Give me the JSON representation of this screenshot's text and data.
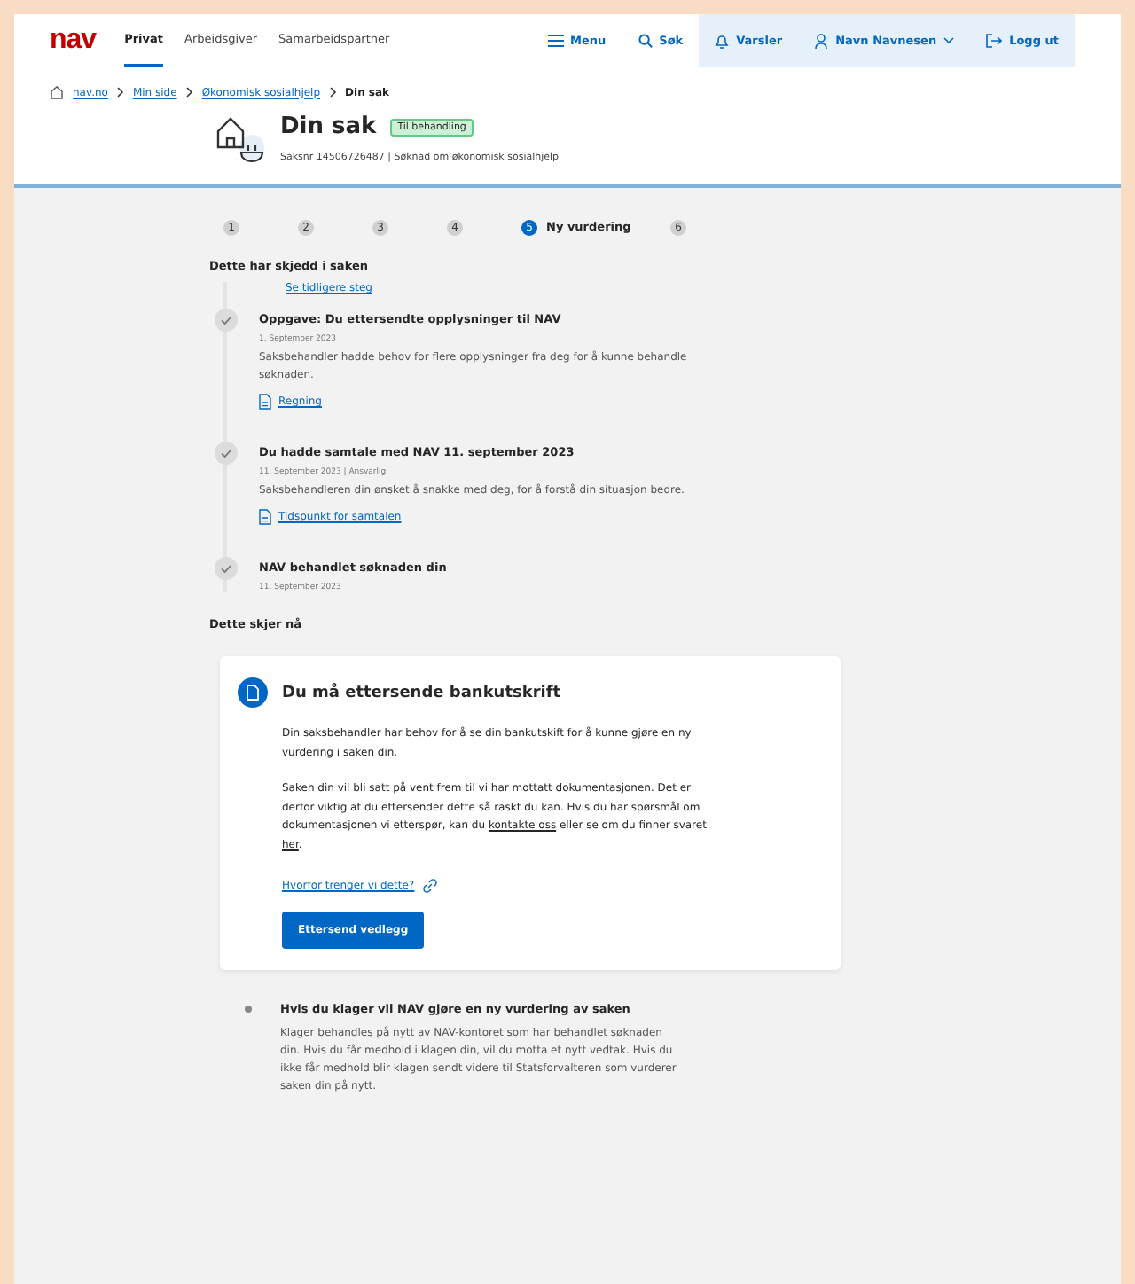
{
  "header": {
    "logo": "nav",
    "tabs": [
      {
        "label": "Privat",
        "selected": true
      },
      {
        "label": "Arbeidsgiver",
        "selected": false
      },
      {
        "label": "Samarbeidspartner",
        "selected": false
      }
    ],
    "actions": [
      {
        "label": "Menu",
        "kind": "menu",
        "highlighted": false
      },
      {
        "label": "Søk",
        "kind": "search",
        "highlighted": false
      },
      {
        "label": "Varsler",
        "kind": "bell",
        "highlighted": true
      },
      {
        "label": "Navn Navnesen",
        "kind": "user",
        "highlighted": true
      },
      {
        "label": "Logg ut",
        "kind": "logout",
        "highlighted": true
      }
    ]
  },
  "breadcrumbs": [
    {
      "label": "nav.no",
      "link": true
    },
    {
      "label": "Min side",
      "link": true
    },
    {
      "label": "Økonomisk sosialhjelp",
      "link": true
    },
    {
      "label": "Din sak",
      "link": false
    }
  ],
  "case": {
    "title": "Din sak",
    "badge": "Til behandling",
    "meta": "Saksnr 14506726487  |  Søknad om økonomisk sosialhjelp"
  },
  "steps": [
    {
      "number": "1",
      "selected": false
    },
    {
      "number": "2",
      "selected": false
    },
    {
      "number": "3",
      "selected": false
    },
    {
      "number": "4",
      "selected": false
    },
    {
      "number": "5",
      "label": "Ny vurdering",
      "selected": true
    },
    {
      "number": "6",
      "selected": false
    }
  ],
  "history": {
    "heading": "Dette har skjedd i saken",
    "earlier_link": "Se tidligere steg",
    "events": [
      {
        "title": "Oppgave: Du ettersendte opplysninger til NAV",
        "date": "1. September 2023",
        "text": "Saksbehandler hadde behov for flere opplysninger fra deg for å kunne behandle søknaden.",
        "link": "Regning"
      },
      {
        "title": "Du hadde samtale med NAV 11. september 2023",
        "date": "11. September 2023 | Ansvarlig",
        "text": "Saksbehandleren din ønsket å snakke med deg, for å forstå din situasjon bedre.",
        "link": "Tidspunkt for samtalen"
      },
      {
        "title": "NAV behandlet søknaden din",
        "date": "11. September 2023"
      }
    ]
  },
  "now": {
    "heading": "Dette skjer nå",
    "card": {
      "title": "Du må ettersende bankutskrift",
      "paragraphs": [
        [
          {
            "kind": "text",
            "text": "Din saksbehandler har behov for å se din bankutskift for å kunne gjøre en ny vurdering i saken din."
          }
        ],
        [
          {
            "kind": "text",
            "text": "Saken din vil bli satt på vent frem til vi har mottatt dokumentasjonen. Det er derfor viktig at du ettersender dette så raskt du kan. Hvis du har spørsmål om dokumentasjonen vi etterspør, kan du "
          },
          {
            "kind": "link",
            "text": "kontakte oss"
          },
          {
            "kind": "text",
            "text": " eller se om du finner svaret "
          },
          {
            "kind": "link",
            "text": "her"
          },
          {
            "kind": "text",
            "text": "."
          }
        ]
      ],
      "link": "Hvorfor trenger vi dette?",
      "button": "Ettersend vedlegg"
    }
  },
  "upcoming": [
    {
      "title": "Hvis du klager vil NAV gjøre en ny vurdering av saken",
      "text": "Klager behandles på nytt av NAV-kontoret som har behandlet søknaden din. Hvis du får medhold i klagen din, vil du motta et nytt vedtak. Hvis du ikke får medhold blir klagen sendt videre til Statsforvalteren som vurderer saken din på nytt."
    }
  ]
}
